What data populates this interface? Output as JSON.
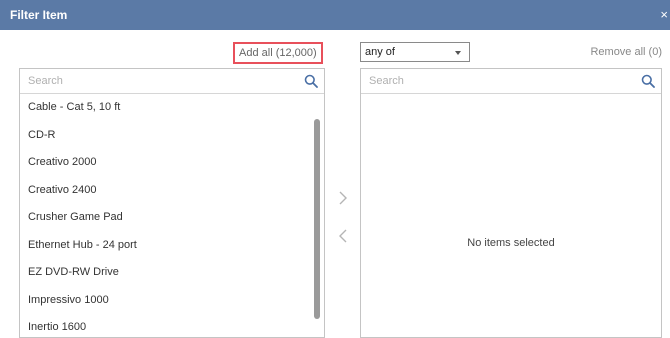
{
  "dialog": {
    "title": "Filter Item",
    "close_symbol": "×"
  },
  "left_panel": {
    "add_all_label": "Add all (12,000)",
    "search_placeholder": "Search",
    "items": [
      "Cable - Cat 5, 10 ft",
      "CD-R",
      "Creativo 2000",
      "Creativo 2400",
      "Crusher Game Pad",
      "Ethernet Hub - 24 port",
      "EZ DVD-RW Drive",
      "Impressivo 1000",
      "Inertio 1600"
    ]
  },
  "right_panel": {
    "match_select_value": "any of",
    "remove_all_label": "Remove all (0)",
    "search_placeholder": "Search",
    "empty_message": "No items selected"
  },
  "transfer": {
    "add_icon": "chevron-right-icon",
    "remove_icon": "chevron-left-icon"
  },
  "colors": {
    "titlebar": "#5b7aa6",
    "highlight_border": "#e8505b",
    "search_icon": "#4a6fa5"
  }
}
